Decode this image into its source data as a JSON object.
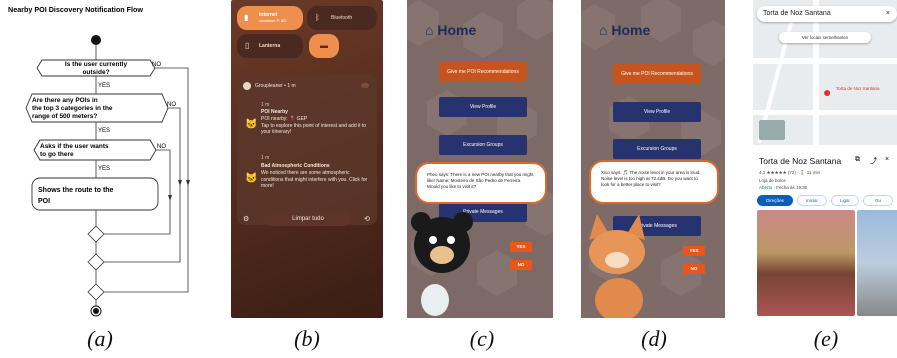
{
  "flow": {
    "title": "Nearby POI Discovery Notification Flow",
    "q1": "Is the user currently outside?",
    "q2": "Are there any POIs in the top 3 categories in the range of 500 meters?",
    "q3": "Asks if the user wants to go there",
    "action": "Shows the route to the POI",
    "yes": "YES",
    "no": "NO",
    "caption": "(a)"
  },
  "phone": {
    "tiles": [
      {
        "label": "Internet",
        "sub": "vodafone P. 5G"
      },
      {
        "label": "Bluetooth"
      },
      {
        "label": "Lanterna"
      }
    ],
    "header": "Groupleaner • 1 m",
    "n1_time": "1 m",
    "n1_title": "POI Nearby",
    "n1_body": "POI nearby: 📍 GEP\nTap to explore this point of interest and add it to your itinerary!",
    "n2_time": "1 m",
    "n2_title": "Bad Atmospheric Conditions",
    "n2_body": "We noticed there are some atmospheric conditions that might interfere with you. Click for more!",
    "clear": "Limpar tudo",
    "caption": "(b)"
  },
  "game_c": {
    "home": "Home",
    "btn1": "Give me POI Recommendations",
    "btn2": "View Profile",
    "btn3": "Excursion Groups",
    "btn4": "Private Messages",
    "dialog": "Pheo says: There is a new POI nearby that you might like! Name: Mosteiro de São Pedro de Ferreira. Would you like to visit it?",
    "yes": "YES",
    "no": "NO",
    "caption": "(c)"
  },
  "game_d": {
    "home": "Home",
    "btn1": "Give me POI Recommendations",
    "btn2": "View Profile",
    "btn3": "Excursion Groups",
    "btn4": "Private Messages",
    "dialog": "Xico says: 🎵 The noise level in your area is loud. Noise level is too high at 72.4dB. Do you want to look for a better place to visit?",
    "yes": "YES",
    "no": "NO",
    "caption": "(d)"
  },
  "maps": {
    "search": "Torta de Noz Santana",
    "similar": "Ver locais semelhantes",
    "pin_label": "Torta de Noz Santana",
    "place": "Torta de Noz Santana",
    "rating": "4,1 ★★★★★ (72) · 🚶 11 min",
    "category": "Loja de bolos",
    "hours_open": "Aberto",
    "hours": " · Fecha às 19:30",
    "chips": [
      "Direções",
      "Iniciar",
      "Ligar",
      "Gu"
    ],
    "caption": "(e)"
  }
}
